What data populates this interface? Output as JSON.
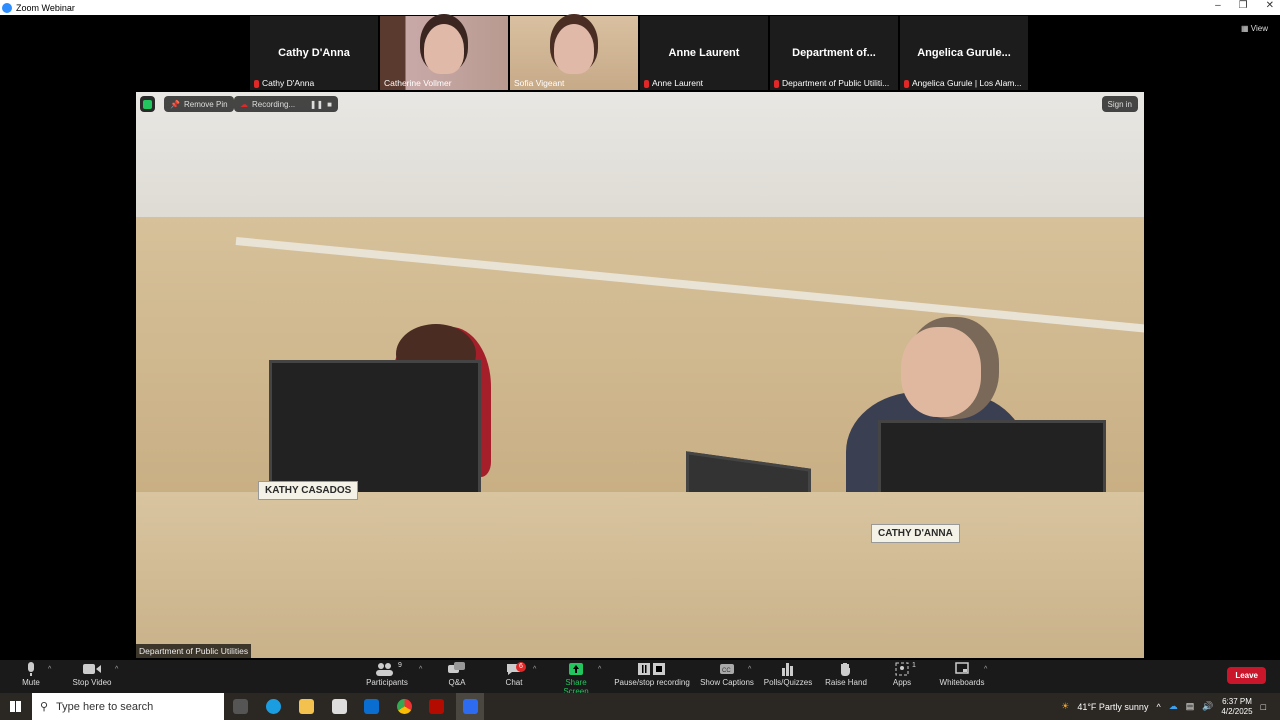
{
  "window": {
    "title": "Zoom Webinar",
    "view_label": "View"
  },
  "participants": [
    {
      "display": "Cathy D'Anna",
      "label": "Cathy D'Anna",
      "video": false
    },
    {
      "display": "",
      "label": "Catherine Vollmer",
      "video": true
    },
    {
      "display": "",
      "label": "Sofia Vigeant",
      "video": true
    },
    {
      "display": "Anne Laurent",
      "label": "Anne Laurent",
      "video": false
    },
    {
      "display": "Department of...",
      "label": "Department of Public Utiliti...",
      "video": false
    },
    {
      "display": "Angelica Gurule...",
      "label": "Angelica Gurule | Los Alam...",
      "video": false
    }
  ],
  "video": {
    "remove_pin": "Remove Pin",
    "recording": "Recording...",
    "sign_in": "Sign in",
    "speaker_label": "Department of Public Utilities",
    "nameplate_left": "KATHY CASADOS",
    "nameplate_right": "CATHY D'ANNA"
  },
  "toolbar": {
    "mute": "Mute",
    "stop_video": "Stop Video",
    "participants": "Participants",
    "participants_count": "9",
    "qa": "Q&A",
    "chat": "Chat",
    "chat_badge": "6",
    "share": "Share Screen",
    "pause_rec": "Pause/stop recording",
    "captions": "Show Captions",
    "polls": "Polls/Quizzes",
    "raise": "Raise Hand",
    "apps": "Apps",
    "apps_count": "1",
    "whiteboards": "Whiteboards",
    "leave": "Leave"
  },
  "taskbar": {
    "search_placeholder": "Type here to search",
    "weather": "41°F  Partly sunny",
    "time": "6:37 PM",
    "date": "4/2/2025"
  },
  "colors": {
    "share": "#22c55e",
    "leave": "#c9162b",
    "badge": "#e02828"
  }
}
